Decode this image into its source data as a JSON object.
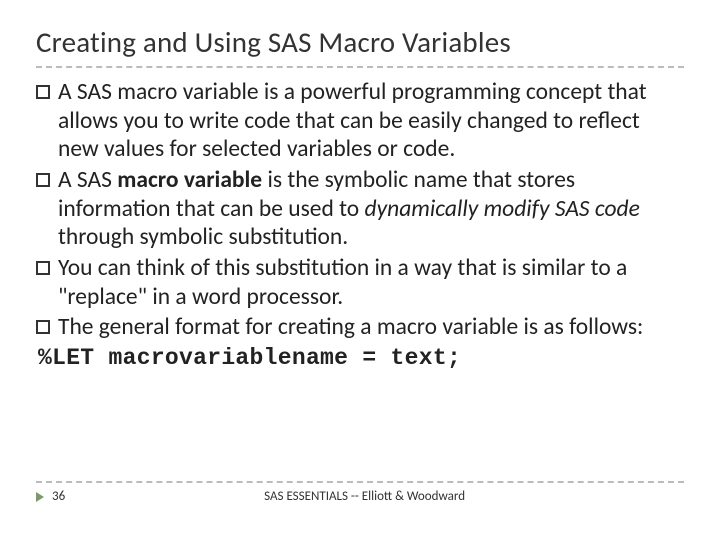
{
  "title": "Creating and Using SAS Macro Variables",
  "bullets": {
    "b1": {
      "pre": "A SAS macro variable is a powerful programming concept that allows you to write code that can be easily changed to reflect new values for selected variables or code."
    },
    "b2": {
      "pre": "A SAS ",
      "bold1": "macro variable",
      "mid1": " is the symbolic name that stores information that can be used to ",
      "ital": "dynamically modify SAS code",
      "tail": " through symbolic substitution."
    },
    "b3": {
      "pre": "You can think of this substitution in a way that is similar to a \"replace\" in a word processor."
    },
    "b4": {
      "pre": "The general format for creating a macro variable is as follows:"
    }
  },
  "code_line": "%LET macrovariablename = text;",
  "footer": {
    "page": "36",
    "text": "SAS ESSENTIALS -- Elliott & Woodward"
  }
}
